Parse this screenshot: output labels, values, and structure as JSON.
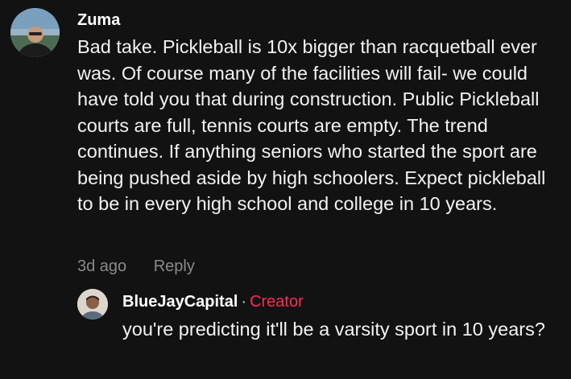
{
  "comment": {
    "author": "Zuma",
    "text": "Bad take. Pickleball is 10x bigger than racquetball ever was. Of course many of the facilities will fail- we could have told you that during construction. Public Pickleball courts are full, tennis courts are empty. The trend continues. If anything seniors who started the sport are being pushed aside by high schoolers. Expect pickleball to be in every high school and college in 10 years.",
    "age": "3d ago",
    "reply_label": "Reply"
  },
  "reply": {
    "author": "BlueJayCapital",
    "separator": "·",
    "badge": "Creator",
    "text": "you're predicting it'll be a varsity sport in 10 years?"
  },
  "colors": {
    "background": "#121212",
    "creator_badge": "#fe2c55",
    "meta_text": "#8a8a8a"
  }
}
